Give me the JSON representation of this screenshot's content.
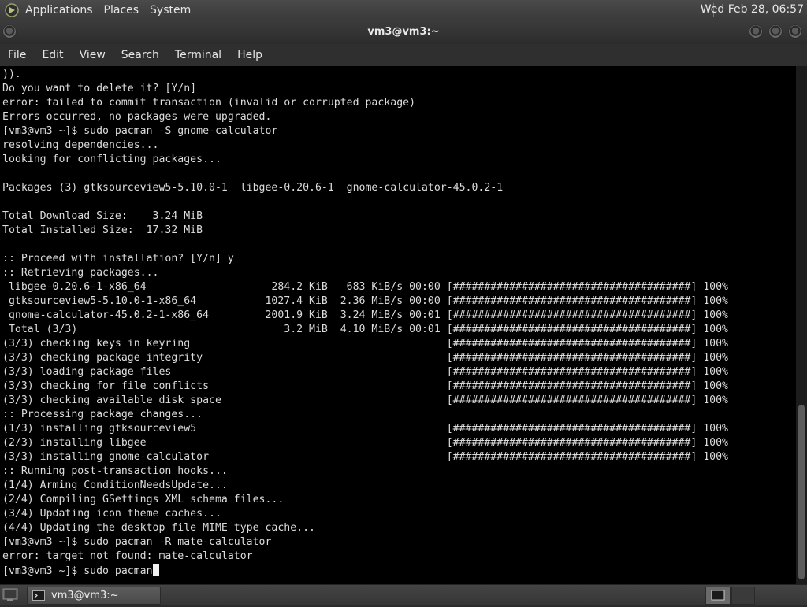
{
  "top_panel": {
    "menus": [
      "Applications",
      "Places",
      "System"
    ],
    "clock": "Wed Feb 28, 06:57"
  },
  "window": {
    "title": "vm3@vm3:~",
    "menus": [
      "File",
      "Edit",
      "View",
      "Search",
      "Terminal",
      "Help"
    ]
  },
  "terminal": {
    "lines": [
      ")).",
      "Do you want to delete it? [Y/n]",
      "error: failed to commit transaction (invalid or corrupted package)",
      "Errors occurred, no packages were upgraded.",
      "[vm3@vm3 ~]$ sudo pacman -S gnome-calculator",
      "resolving dependencies...",
      "looking for conflicting packages...",
      "",
      "Packages (3) gtksourceview5-5.10.0-1  libgee-0.20.6-1  gnome-calculator-45.0.2-1",
      "",
      "Total Download Size:    3.24 MiB",
      "Total Installed Size:  17.32 MiB",
      "",
      ":: Proceed with installation? [Y/n] y",
      ":: Retrieving packages...",
      " libgee-0.20.6-1-x86_64                    284.2 KiB   683 KiB/s 00:00 [######################################] 100%",
      " gtksourceview5-5.10.0-1-x86_64           1027.4 KiB  2.36 MiB/s 00:00 [######################################] 100%",
      " gnome-calculator-45.0.2-1-x86_64         2001.9 KiB  3.24 MiB/s 00:01 [######################################] 100%",
      " Total (3/3)                                 3.2 MiB  4.10 MiB/s 00:01 [######################################] 100%",
      "(3/3) checking keys in keyring                                         [######################################] 100%",
      "(3/3) checking package integrity                                       [######################################] 100%",
      "(3/3) loading package files                                            [######################################] 100%",
      "(3/3) checking for file conflicts                                      [######################################] 100%",
      "(3/3) checking available disk space                                    [######################################] 100%",
      ":: Processing package changes...",
      "(1/3) installing gtksourceview5                                        [######################################] 100%",
      "(2/3) installing libgee                                                [######################################] 100%",
      "(3/3) installing gnome-calculator                                      [######################################] 100%",
      ":: Running post-transaction hooks...",
      "(1/4) Arming ConditionNeedsUpdate...",
      "(2/4) Compiling GSettings XML schema files...",
      "(3/4) Updating icon theme caches...",
      "(4/4) Updating the desktop file MIME type cache...",
      "[vm3@vm3 ~]$ sudo pacman -R mate-calculator",
      "error: target not found: mate-calculator",
      "[vm3@vm3 ~]$ sudo pacman"
    ]
  },
  "taskbar": {
    "task_label": "vm3@vm3:~"
  },
  "colors": {
    "terminal_bg": "#000000",
    "terminal_fg": "#dcdcdc",
    "panel_bg": "#3f3f3f"
  }
}
